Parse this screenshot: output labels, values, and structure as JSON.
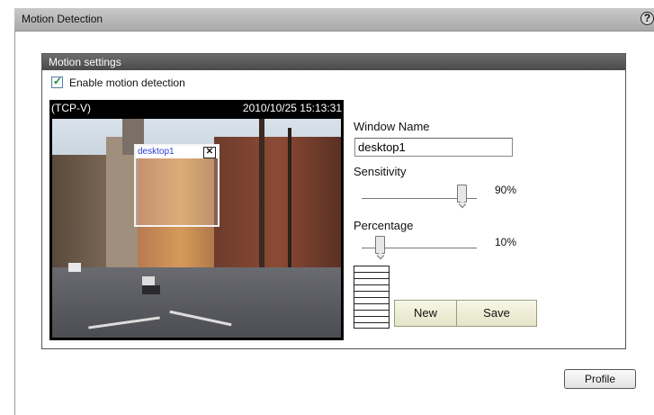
{
  "window": {
    "title": "Motion Detection",
    "help_icon": "question-circle-icon"
  },
  "settings": {
    "header": "Motion settings",
    "enable_label": "Enable motion detection",
    "enable_checked": true
  },
  "video": {
    "title": "(TCP-V)",
    "timestamp": "2010/10/25 15:13:31",
    "window_name": "desktop1",
    "close_glyph": "✕"
  },
  "form": {
    "window_name_label": "Window Name",
    "window_name_value": "desktop1",
    "sensitivity_label": "Sensitivity",
    "sensitivity_value": "90%",
    "sensitivity_level": 0.9,
    "percentage_label": "Percentage",
    "percentage_value": "10%",
    "percentage_level": 0.1
  },
  "buttons": {
    "new": "New",
    "save": "Save",
    "profile": "Profile"
  }
}
